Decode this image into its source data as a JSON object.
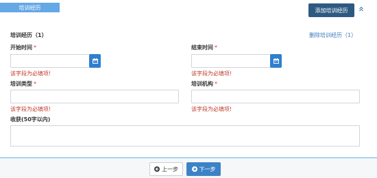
{
  "section": {
    "tab_label": "培训经历"
  },
  "toolbar": {
    "add_label": "添加培训经历"
  },
  "record": {
    "title": "培训经历（1）",
    "delete_label": "删除培训经历（1）"
  },
  "fields": {
    "start_date": {
      "label": "开始时间",
      "required_mark": "*",
      "value": "",
      "error": "该字段为必填项!"
    },
    "end_date": {
      "label": "结束时间",
      "required_mark": "*",
      "value": "",
      "error": "该字段为必填项!"
    },
    "training_type": {
      "label": "培训类型",
      "required_mark": "*",
      "value": "",
      "error": "该字段为必填项!"
    },
    "training_org": {
      "label": "培训机构",
      "required_mark": "*",
      "value": "",
      "error": "该字段为必填项!"
    },
    "gains": {
      "label": "收获(50字以内)",
      "value": ""
    }
  },
  "footer": {
    "prev_label": "上一步",
    "next_label": "下一步"
  },
  "colors": {
    "primary": "#2f7fd0",
    "dark_button": "#2e5a82",
    "error": "#c0392b",
    "link": "#3a7bbd"
  }
}
